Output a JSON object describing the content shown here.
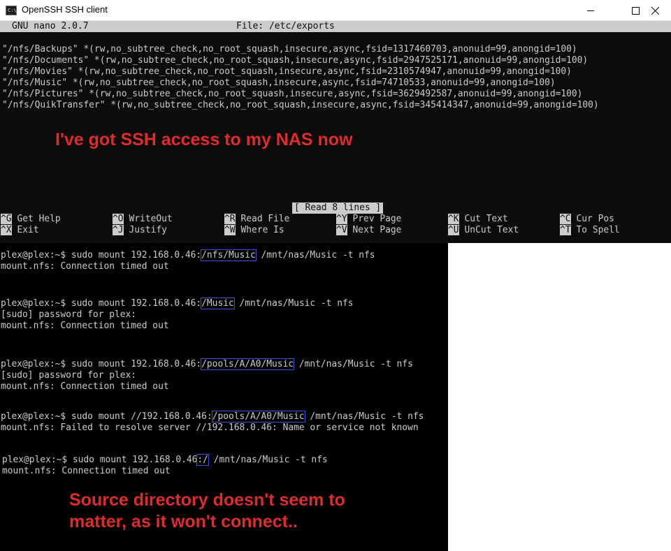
{
  "window": {
    "title": "OpenSSH SSH client",
    "app_icon_text": "C:\\",
    "icons": [
      "minimize-icon",
      "maximize-icon",
      "close-icon"
    ]
  },
  "nano": {
    "version": "GNU nano 2.0.7",
    "file_title": "File: /etc/exports",
    "lines": [
      "\"/nfs/Backups\" *(rw,no_subtree_check,no_root_squash,insecure,async,fsid=1317460703,anonuid=99,anongid=100)",
      "\"/nfs/Documents\" *(rw,no_subtree_check,no_root_squash,insecure,async,fsid=2947525171,anonuid=99,anongid=100)",
      "\"/nfs/Movies\" *(rw,no_subtree_check,no_root_squash,insecure,async,fsid=2310574947,anonuid=99,anongid=100)",
      "\"/nfs/Music\" *(rw,no_subtree_check,no_root_squash,insecure,async,fsid=74710533,anonuid=99,anongid=100)",
      "\"/nfs/Pictures\" *(rw,no_subtree_check,no_root_squash,insecure,async,fsid=3629492587,anonuid=99,anongid=100)",
      "\"/nfs/QuikTransfer\" *(rw,no_subtree_check,no_root_squash,insecure,async,fsid=345414347,anonuid=99,anongid=100)"
    ],
    "status": "[ Read 8 lines ]",
    "shortcuts": [
      {
        "key": "^G",
        "label": "Get Help"
      },
      {
        "key": "^O",
        "label": "WriteOut"
      },
      {
        "key": "^R",
        "label": "Read File"
      },
      {
        "key": "^Y",
        "label": "Prev Page"
      },
      {
        "key": "^K",
        "label": "Cut Text"
      },
      {
        "key": "^C",
        "label": "Cur Pos"
      },
      {
        "key": "^X",
        "label": "Exit"
      },
      {
        "key": "^J",
        "label": "Justify"
      },
      {
        "key": "^W",
        "label": "Where Is"
      },
      {
        "key": "^V",
        "label": "Next Page"
      },
      {
        "key": "^U",
        "label": "UnCut Text"
      },
      {
        "key": "^T",
        "label": "To Spell"
      }
    ]
  },
  "annotations": {
    "top": "I've got SSH access to my NAS now",
    "bottom_line1": "Source directory doesn't seem to",
    "bottom_line2": "matter, as it won't connect.."
  },
  "terminal": {
    "cmd1": {
      "pre": "plex@plex:~$ sudo mount 192.168.0.46:",
      "hl": "/nfs/Music",
      "post": " /mnt/nas/Music -t nfs"
    },
    "out1": "mount.nfs: Connection timed out",
    "cmd2": {
      "pre": "plex@plex:~$ sudo mount 192.168.0.46:",
      "hl": "/Music",
      "post": " /mnt/nas/Music -t nfs"
    },
    "out2a": "[sudo] password for plex:",
    "out2b": "mount.nfs: Connection timed out",
    "cmd3": {
      "pre": "plex@plex:~$ sudo mount 192.168.0.46:",
      "hl": "/pools/A/A0/Music",
      "post": " /mnt/nas/Music -t nfs"
    },
    "out3a": "[sudo] password for plex:",
    "out3b": "mount.nfs: Connection timed out",
    "cmd4": {
      "pre": "plex@plex:~$ sudo mount //192.168.0.46:",
      "hl": "/pools/A/A0/Music",
      "post": " /mnt/nas/Music -t nfs"
    },
    "out4": "mount.nfs: Failed to resolve server //192.168.0.46: Name or service not known",
    "cmd5": {
      "pre": "plex@plex:~$ sudo mount 192.168.0.46",
      "hl": ":/",
      "post": " /mnt/nas/Music -t nfs"
    },
    "out5": "mount.nfs: Connection timed out"
  },
  "colors": {
    "terminal_bg": "#0c0c0c",
    "terminal_fg": "#cccccc",
    "annotation_red": "#e02b2b",
    "highlight_box": "#3a4fd8"
  }
}
